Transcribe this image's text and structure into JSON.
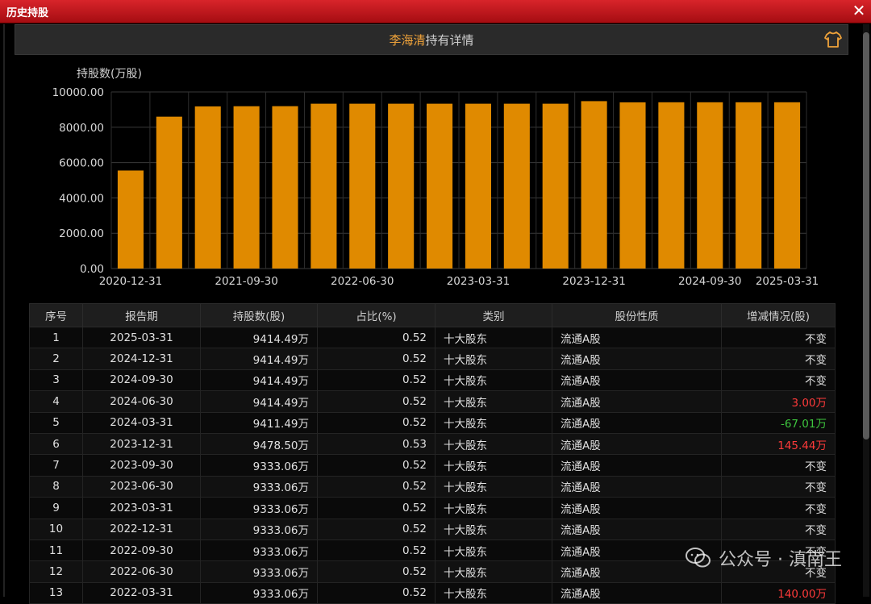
{
  "window": {
    "title": "历史持股",
    "close": "✕"
  },
  "header": {
    "holder_name": "李海清",
    "suffix": "持有详情"
  },
  "chart_data": {
    "type": "bar",
    "ylabel": "持股数(万股)",
    "ylim": [
      0,
      10000
    ],
    "yticks": [
      "0.00",
      "2000.00",
      "4000.00",
      "6000.00",
      "8000.00",
      "10000.00"
    ],
    "xtick_labels": [
      "2020-12-31",
      "2021-09-30",
      "2022-06-30",
      "2023-03-31",
      "2023-12-31",
      "2024-09-30",
      "2025-03-31"
    ],
    "categories": [
      "2020-12-31",
      "2021-03-31",
      "2021-06-30",
      "2021-09-30",
      "2021-12-31",
      "2022-03-31",
      "2022-06-30",
      "2022-09-30",
      "2022-12-31",
      "2023-03-31",
      "2023-06-30",
      "2023-09-30",
      "2023-12-31",
      "2024-03-31",
      "2024-06-30",
      "2024-09-30",
      "2024-12-31",
      "2025-03-31"
    ],
    "values": [
      5550,
      8600,
      9180,
      9190,
      9193,
      9333.06,
      9333.06,
      9333.06,
      9333.06,
      9333.06,
      9333.06,
      9333.06,
      9478.5,
      9411.49,
      9414.49,
      9414.49,
      9414.49,
      9414.49
    ],
    "bar_color": "#e08a00",
    "grid": true
  },
  "table": {
    "headers": [
      "序号",
      "报告期",
      "持股数(股)",
      "占比(%)",
      "类别",
      "股份性质",
      "增减情况(股)"
    ],
    "rows": [
      [
        "1",
        "2025-03-31",
        "9414.49万",
        "0.52",
        "十大股东",
        "流通A股",
        "不变"
      ],
      [
        "2",
        "2024-12-31",
        "9414.49万",
        "0.52",
        "十大股东",
        "流通A股",
        "不变"
      ],
      [
        "3",
        "2024-09-30",
        "9414.49万",
        "0.52",
        "十大股东",
        "流通A股",
        "不变"
      ],
      [
        "4",
        "2024-06-30",
        "9414.49万",
        "0.52",
        "十大股东",
        "流通A股",
        "3.00万"
      ],
      [
        "5",
        "2024-03-31",
        "9411.49万",
        "0.52",
        "十大股东",
        "流通A股",
        "-67.01万"
      ],
      [
        "6",
        "2023-12-31",
        "9478.50万",
        "0.53",
        "十大股东",
        "流通A股",
        "145.44万"
      ],
      [
        "7",
        "2023-09-30",
        "9333.06万",
        "0.52",
        "十大股东",
        "流通A股",
        "不变"
      ],
      [
        "8",
        "2023-06-30",
        "9333.06万",
        "0.52",
        "十大股东",
        "流通A股",
        "不变"
      ],
      [
        "9",
        "2023-03-31",
        "9333.06万",
        "0.52",
        "十大股东",
        "流通A股",
        "不变"
      ],
      [
        "10",
        "2022-12-31",
        "9333.06万",
        "0.52",
        "十大股东",
        "流通A股",
        "不变"
      ],
      [
        "11",
        "2022-09-30",
        "9333.06万",
        "0.52",
        "十大股东",
        "流通A股",
        "不变"
      ],
      [
        "12",
        "2022-06-30",
        "9333.06万",
        "0.52",
        "十大股东",
        "流通A股",
        "不变"
      ],
      [
        "13",
        "2022-03-31",
        "9333.06万",
        "0.52",
        "十大股东",
        "流通A股",
        "140.00万"
      ]
    ],
    "change_colors": {
      "up": "#ff3a3a",
      "down": "#3ec53e"
    }
  },
  "watermark": {
    "text": "公众号 · 滇南王",
    "icon": "wechat-icon"
  }
}
